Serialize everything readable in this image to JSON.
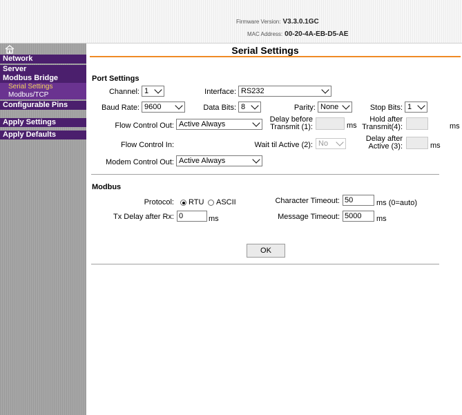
{
  "header": {
    "firmware_label": "Firmware Version:",
    "firmware_value": "V3.3.0.1GC",
    "mac_label": "MAC Address:",
    "mac_value": "00-20-4A-EB-D5-AE"
  },
  "sidebar": {
    "items": [
      {
        "label": "Network"
      },
      {
        "label": "Server"
      },
      {
        "label": "Modbus Bridge"
      },
      {
        "label": "Serial Settings",
        "active": true
      },
      {
        "label": "Modbus/TCP"
      },
      {
        "label": "Configurable Pins"
      },
      {
        "label": "Apply Settings"
      },
      {
        "label": "Apply Defaults"
      }
    ]
  },
  "page": {
    "title": "Serial Settings"
  },
  "port": {
    "section": "Port Settings",
    "channel_label": "Channel:",
    "channel_value": "1",
    "interface_label": "Interface:",
    "interface_value": "RS232",
    "baud_label": "Baud Rate:",
    "baud_value": "9600",
    "databits_label": "Data Bits:",
    "databits_value": "8",
    "parity_label": "Parity:",
    "parity_value": "None",
    "stopbits_label": "Stop Bits:",
    "stopbits_value": "1",
    "flowout_label": "Flow Control Out:",
    "flowout_value": "Active Always",
    "delay_before_l1": "Delay before",
    "delay_before_l2": "Transmit (1):",
    "hold_after_l1": "Hold after",
    "hold_after_l2": "Transmit(4):",
    "ms": "ms",
    "flowin_label": "Flow Control In:",
    "wait_label": "Wait til Active (2):",
    "wait_value": "No",
    "delay_after_l1": "Delay after",
    "delay_after_l2": "Active (3):",
    "modem_label": "Modem Control Out:",
    "modem_value": "Active Always"
  },
  "modbus": {
    "section": "Modbus",
    "protocol_label": "Protocol:",
    "rtu_label": "RTU",
    "ascii_label": "ASCII",
    "selected": "RTU",
    "char_timeout_label": "Character Timeout:",
    "char_timeout_value": "50",
    "char_timeout_unit": "ms (0=auto)",
    "tx_delay_label": "Tx Delay after Rx:",
    "tx_delay_value": "0",
    "tx_delay_unit": "ms",
    "msg_timeout_label": "Message Timeout:",
    "msg_timeout_value": "5000",
    "msg_timeout_unit": "ms"
  },
  "actions": {
    "ok_label": "OK"
  }
}
